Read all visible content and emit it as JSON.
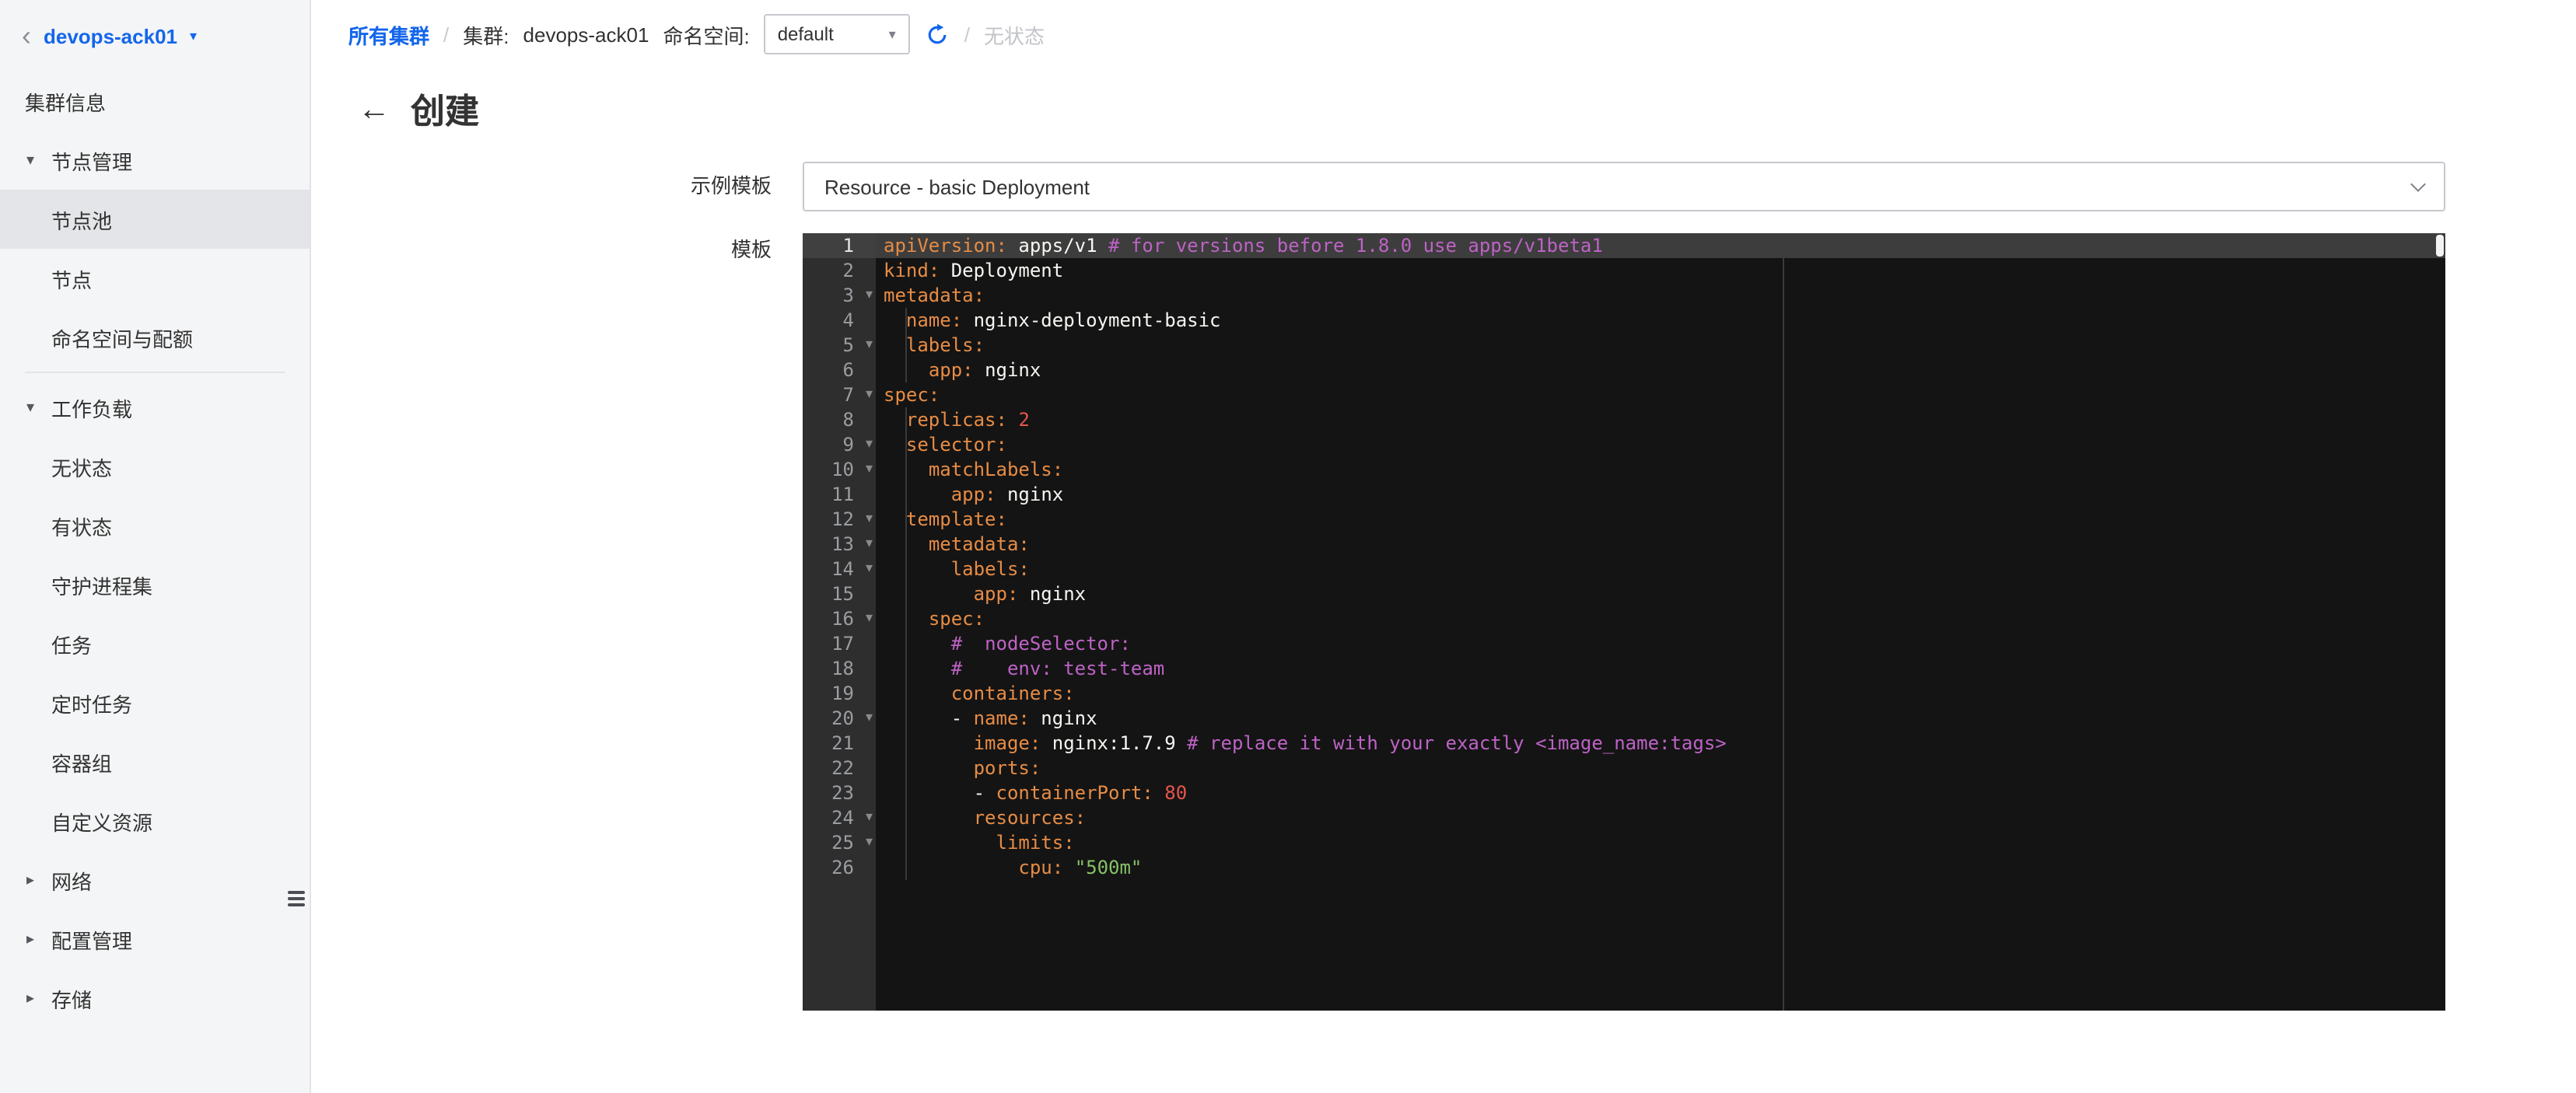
{
  "colors": {
    "accent_blue": "#1366ec",
    "sidebar_bg": "#f4f5f6",
    "sidebar_selected_bg": "#e4e5e8",
    "editor_bg": "#141414",
    "editor_gutter_bg": "#2e2e2e",
    "editor_active_line": "#3d3d3d",
    "syntax_key": "#e78c45",
    "syntax_plain": "#f6f6f2",
    "syntax_comment": "#bd63c5",
    "syntax_number": "#e8554d",
    "syntax_string": "#86c166"
  },
  "icons": {
    "back_chevron": "‹",
    "cluster_caret": "▾",
    "select_caret": "▾",
    "group_expanded": "▾",
    "group_collapsed": "▸",
    "fold": "▾",
    "title_back_arrow": "←"
  },
  "sidebar": {
    "cluster_name": "devops-ack01",
    "items": [
      {
        "id": "cluster-info",
        "label": "集群信息",
        "type": "item"
      },
      {
        "id": "node-management",
        "label": "节点管理",
        "type": "group",
        "expanded": true
      },
      {
        "id": "node-pool",
        "label": "节点池",
        "type": "child",
        "selected": true
      },
      {
        "id": "node",
        "label": "节点",
        "type": "child"
      },
      {
        "id": "namespace-quota",
        "label": "命名空间与配额",
        "type": "child"
      },
      {
        "type": "divider"
      },
      {
        "id": "workloads",
        "label": "工作负载",
        "type": "group",
        "expanded": true
      },
      {
        "id": "stateless",
        "label": "无状态",
        "type": "child"
      },
      {
        "id": "stateful",
        "label": "有状态",
        "type": "child"
      },
      {
        "id": "daemonset",
        "label": "守护进程集",
        "type": "child"
      },
      {
        "id": "job",
        "label": "任务",
        "type": "child"
      },
      {
        "id": "cronjob",
        "label": "定时任务",
        "type": "child"
      },
      {
        "id": "pods",
        "label": "容器组",
        "type": "child"
      },
      {
        "id": "custom-resource",
        "label": "自定义资源",
        "type": "child"
      },
      {
        "id": "network",
        "label": "网络",
        "type": "group",
        "expanded": false
      },
      {
        "id": "config-management",
        "label": "配置管理",
        "type": "group",
        "expanded": false
      },
      {
        "id": "storage",
        "label": "存储",
        "type": "group",
        "expanded": false
      }
    ]
  },
  "breadcrumb": {
    "all_clusters": "所有集群",
    "separator": "/",
    "cluster_label": "集群:",
    "cluster_name": "devops-ack01",
    "namespace_label": "命名空间:",
    "namespace_value": "default",
    "current_page": "无状态"
  },
  "page": {
    "title": "创建"
  },
  "form": {
    "sample_template_label": "示例模板",
    "sample_template_value": "Resource - basic Deployment",
    "template_label": "模板"
  },
  "editor": {
    "language": "yaml",
    "active_line": 1,
    "fold_lines": [
      3,
      5,
      7,
      9,
      10,
      12,
      13,
      14,
      16,
      20,
      24,
      25
    ],
    "lines": [
      {
        "n": 1,
        "tokens": [
          [
            "k",
            "apiVersion:"
          ],
          [
            "p",
            " apps/v1 "
          ],
          [
            "c",
            "# for versions before 1.8.0 use apps/v1beta1"
          ]
        ]
      },
      {
        "n": 2,
        "tokens": [
          [
            "k",
            "kind:"
          ],
          [
            "p",
            " Deployment"
          ]
        ]
      },
      {
        "n": 3,
        "tokens": [
          [
            "k",
            "metadata:"
          ]
        ]
      },
      {
        "n": 4,
        "tokens": [
          [
            "p",
            "  "
          ],
          [
            "k",
            "name:"
          ],
          [
            "p",
            " nginx-deployment-basic"
          ]
        ]
      },
      {
        "n": 5,
        "tokens": [
          [
            "p",
            "  "
          ],
          [
            "k",
            "labels:"
          ]
        ]
      },
      {
        "n": 6,
        "tokens": [
          [
            "p",
            "    "
          ],
          [
            "k",
            "app:"
          ],
          [
            "p",
            " nginx"
          ]
        ]
      },
      {
        "n": 7,
        "tokens": [
          [
            "k",
            "spec:"
          ]
        ]
      },
      {
        "n": 8,
        "tokens": [
          [
            "p",
            "  "
          ],
          [
            "k",
            "replicas:"
          ],
          [
            "p",
            " "
          ],
          [
            "n",
            "2"
          ]
        ]
      },
      {
        "n": 9,
        "tokens": [
          [
            "p",
            "  "
          ],
          [
            "k",
            "selector:"
          ]
        ]
      },
      {
        "n": 10,
        "tokens": [
          [
            "p",
            "    "
          ],
          [
            "k",
            "matchLabels:"
          ]
        ]
      },
      {
        "n": 11,
        "tokens": [
          [
            "p",
            "      "
          ],
          [
            "k",
            "app:"
          ],
          [
            "p",
            " nginx"
          ]
        ]
      },
      {
        "n": 12,
        "tokens": [
          [
            "p",
            "  "
          ],
          [
            "k",
            "template:"
          ]
        ]
      },
      {
        "n": 13,
        "tokens": [
          [
            "p",
            "    "
          ],
          [
            "k",
            "metadata:"
          ]
        ]
      },
      {
        "n": 14,
        "tokens": [
          [
            "p",
            "      "
          ],
          [
            "k",
            "labels:"
          ]
        ]
      },
      {
        "n": 15,
        "tokens": [
          [
            "p",
            "        "
          ],
          [
            "k",
            "app:"
          ],
          [
            "p",
            " nginx"
          ]
        ]
      },
      {
        "n": 16,
        "tokens": [
          [
            "p",
            "    "
          ],
          [
            "k",
            "spec:"
          ]
        ]
      },
      {
        "n": 17,
        "tokens": [
          [
            "p",
            "      "
          ],
          [
            "c",
            "#  nodeSelector:"
          ]
        ]
      },
      {
        "n": 18,
        "tokens": [
          [
            "p",
            "      "
          ],
          [
            "c",
            "#    env: test-team"
          ]
        ]
      },
      {
        "n": 19,
        "tokens": [
          [
            "p",
            "      "
          ],
          [
            "k",
            "containers:"
          ]
        ]
      },
      {
        "n": 20,
        "tokens": [
          [
            "p",
            "      - "
          ],
          [
            "k",
            "name:"
          ],
          [
            "p",
            " nginx"
          ]
        ]
      },
      {
        "n": 21,
        "tokens": [
          [
            "p",
            "        "
          ],
          [
            "k",
            "image:"
          ],
          [
            "p",
            " nginx:1.7.9 "
          ],
          [
            "c",
            "# replace it with your exactly <image_name:tags>"
          ]
        ]
      },
      {
        "n": 22,
        "tokens": [
          [
            "p",
            "        "
          ],
          [
            "k",
            "ports:"
          ]
        ]
      },
      {
        "n": 23,
        "tokens": [
          [
            "p",
            "        - "
          ],
          [
            "k",
            "containerPort:"
          ],
          [
            "p",
            " "
          ],
          [
            "n",
            "80"
          ]
        ]
      },
      {
        "n": 24,
        "tokens": [
          [
            "p",
            "        "
          ],
          [
            "k",
            "resources:"
          ]
        ]
      },
      {
        "n": 25,
        "tokens": [
          [
            "p",
            "          "
          ],
          [
            "k",
            "limits:"
          ]
        ]
      },
      {
        "n": 26,
        "tokens": [
          [
            "p",
            "            "
          ],
          [
            "k",
            "cpu:"
          ],
          [
            "p",
            " "
          ],
          [
            "s",
            "\"500m\""
          ]
        ]
      }
    ]
  }
}
